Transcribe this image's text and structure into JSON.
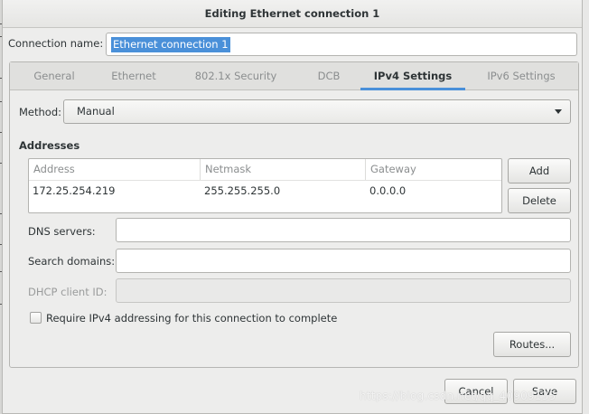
{
  "window": {
    "title": "Editing Ethernet connection 1"
  },
  "connection": {
    "label": "Connection name:",
    "value": "Ethernet connection 1"
  },
  "tabs": [
    {
      "label": "General"
    },
    {
      "label": "Ethernet"
    },
    {
      "label": "802.1x Security"
    },
    {
      "label": "DCB"
    },
    {
      "label": "IPv4 Settings",
      "active": true
    },
    {
      "label": "IPv6 Settings"
    }
  ],
  "ipv4": {
    "method_label": "Method:",
    "method_value": "Manual",
    "addresses_title": "Addresses",
    "columns": [
      "Address",
      "Netmask",
      "Gateway"
    ],
    "rows": [
      [
        "172.25.254.219",
        "255.255.255.0",
        "0.0.0.0"
      ]
    ],
    "add_label": "Add",
    "delete_label": "Delete",
    "dns_label": "DNS servers:",
    "dns_value": "",
    "search_label": "Search domains:",
    "search_value": "",
    "dhcp_label": "DHCP client ID:",
    "dhcp_value": "",
    "require_label": "Require IPv4 addressing for this connection to complete",
    "require_checked": false,
    "routes_label": "Routes..."
  },
  "footer": {
    "cancel_label": "Cancel",
    "save_label": "Save"
  },
  "watermark": "https://blog.csdn.net/qq_40909135",
  "colors": {
    "accent": "#4a90d9",
    "selection": "#4a90d9"
  },
  "icons": {
    "method_dropdown": "chevron-down-icon",
    "require_checkbox": "checkbox-icon"
  }
}
